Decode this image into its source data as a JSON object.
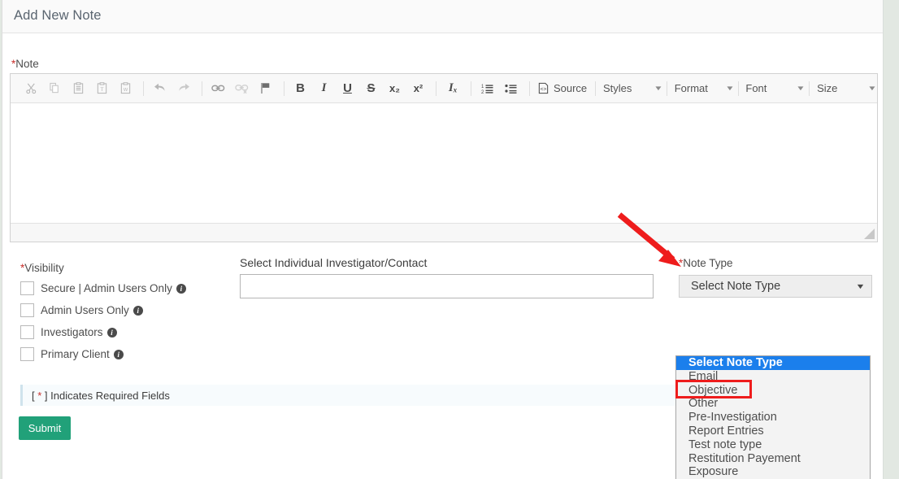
{
  "header": {
    "title": "Add New Note"
  },
  "note_field": {
    "label": "Note",
    "required_star": "*"
  },
  "editor": {
    "toolbar_icons": [
      {
        "name": "cut-icon",
        "glyph": "✂"
      },
      {
        "name": "copy-icon",
        "glyph": "❐"
      },
      {
        "name": "paste-icon",
        "glyph": "ὌB"
      },
      {
        "name": "paste-text-icon",
        "glyph": "T"
      },
      {
        "name": "paste-word-icon",
        "glyph": "W"
      },
      {
        "name": "undo-icon",
        "glyph": "↶"
      },
      {
        "name": "redo-icon",
        "glyph": "↷"
      },
      {
        "name": "link-icon",
        "glyph": "ὑ7"
      },
      {
        "name": "unlink-icon",
        "glyph": "ὑ7"
      },
      {
        "name": "anchor-flag-icon",
        "glyph": "⚑"
      }
    ],
    "format_buttons": [
      {
        "name": "bold-button",
        "label": "B"
      },
      {
        "name": "italic-button",
        "label": "I"
      },
      {
        "name": "underline-button",
        "label": "U"
      },
      {
        "name": "strikethrough-button",
        "label": "S"
      },
      {
        "name": "subscript-button",
        "label": "x₂"
      },
      {
        "name": "superscript-button",
        "label": "x²"
      },
      {
        "name": "remove-format-button",
        "label": "Iₓ"
      },
      {
        "name": "numbered-list-button",
        "label": "1≡"
      },
      {
        "name": "bulleted-list-button",
        "label": "•≡"
      }
    ],
    "source_label": "Source",
    "combos": [
      {
        "name": "styles-dropdown",
        "label": "Styles"
      },
      {
        "name": "format-dropdown",
        "label": "Format"
      },
      {
        "name": "font-dropdown",
        "label": "Font"
      },
      {
        "name": "size-dropdown",
        "label": "Size"
      }
    ],
    "caret": "▼",
    "content": ""
  },
  "visibility": {
    "label": "Visibility",
    "required_star": "*",
    "options": [
      {
        "label": "Secure | Admin Users Only",
        "checked": false,
        "info": "i"
      },
      {
        "label": "Admin Users Only",
        "checked": false,
        "info": "i"
      },
      {
        "label": "Investigators",
        "checked": false,
        "info": "i"
      },
      {
        "label": "Primary Client",
        "checked": false,
        "info": "i"
      }
    ]
  },
  "investigator": {
    "label": "Select Individual Investigator/Contact",
    "value": "",
    "placeholder": ""
  },
  "note_type": {
    "label": "Note Type",
    "required_star": "*",
    "selected": "Select Note Type",
    "arrow": "▼",
    "options": [
      "Select Note Type",
      "Email",
      "Objective",
      "Other",
      "Pre-Investigation",
      "Report Entries",
      "Test note type",
      "Restitution Payement",
      "Exposure"
    ],
    "highlighted_index": 0,
    "annotated_option": "Objective"
  },
  "required_note": {
    "prefix": "[ ",
    "star": "*",
    "suffix": " ] Indicates Required Fields"
  },
  "submit": {
    "label": "Submit"
  },
  "colors": {
    "accent_green": "#21a179",
    "required_red": "#c9302c",
    "annotation_red": "#ee1c1c",
    "select_highlight_blue": "#1b7fec",
    "page_background": "#e2e8e2"
  }
}
